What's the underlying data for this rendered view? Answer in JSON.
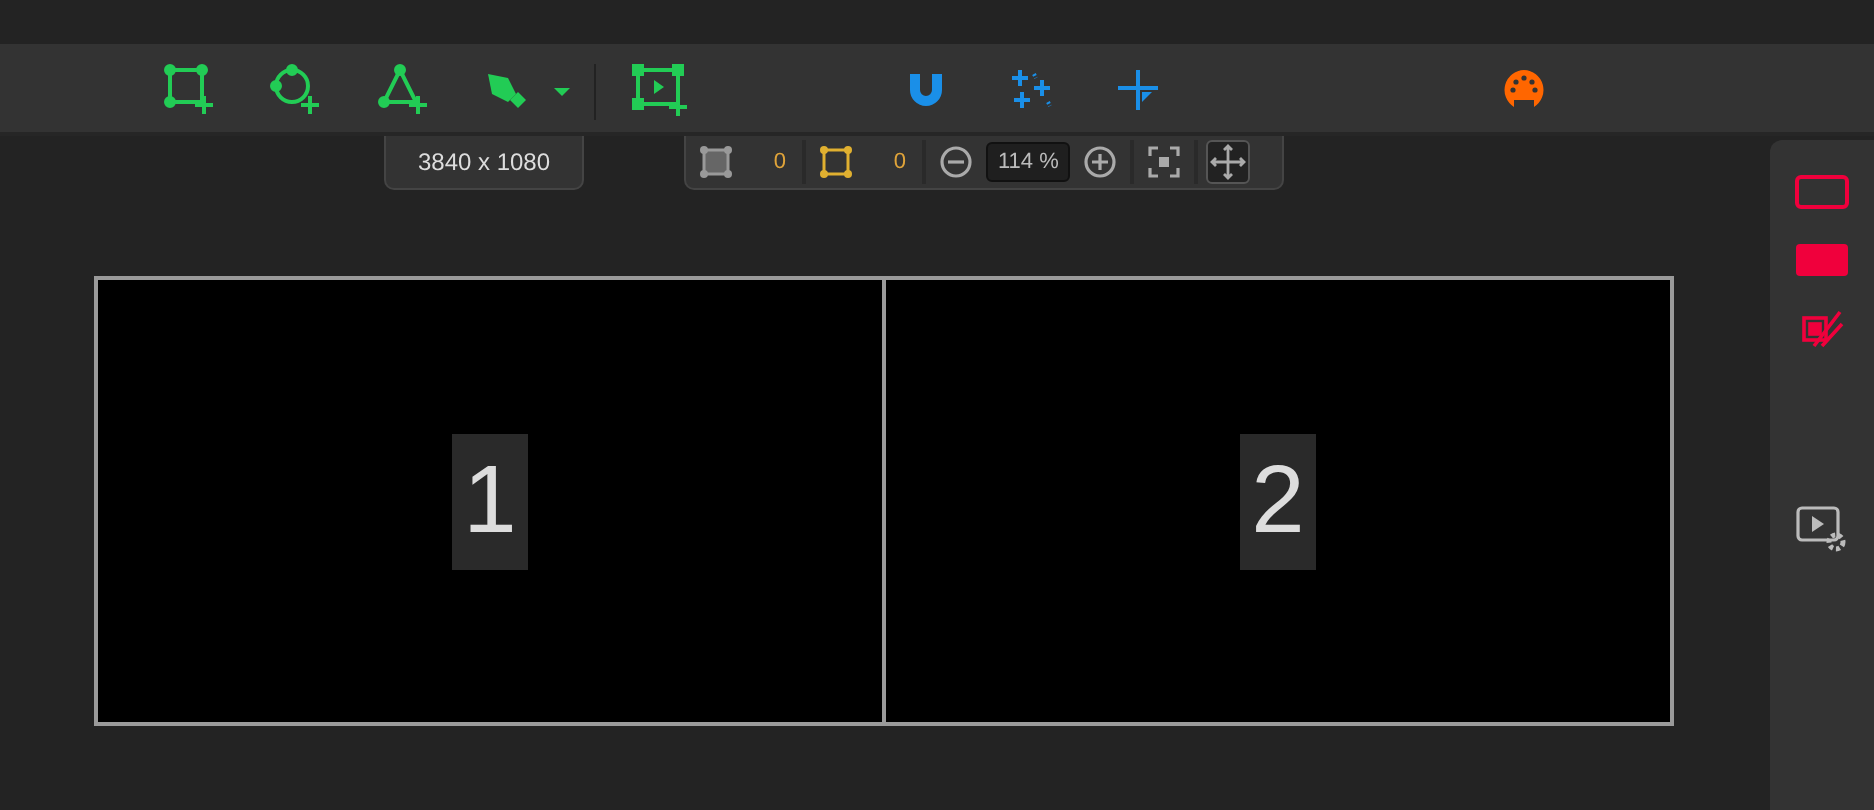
{
  "resolution_tooltip": "3840 x 1080",
  "view_toolbar": {
    "point_counts": [
      "0",
      "0"
    ],
    "zoom": "114 %",
    "move_on": true
  },
  "screens": [
    {
      "label": "1"
    },
    {
      "label": "2"
    }
  ]
}
